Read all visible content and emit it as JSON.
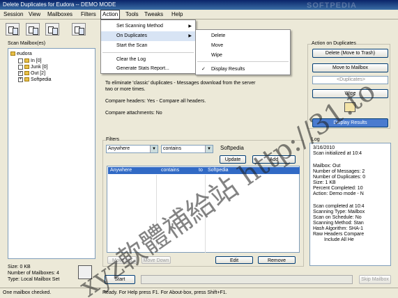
{
  "window": {
    "title": "Delete Duplicates for Eudora -- DEMO MODE",
    "watermark_brand": "SOFTPEDIA"
  },
  "menubar": [
    "Session",
    "View",
    "Mailboxes",
    "Filters",
    "Action",
    "Tools",
    "Tweaks",
    "Help"
  ],
  "action_menu": {
    "items": [
      "Set Scanning Method",
      "On Duplicates",
      "Start the Scan",
      "Clear the Log",
      "Generate Stats Report..."
    ],
    "submenu": [
      "Delete",
      "Move",
      "Wipe",
      "Display Results"
    ]
  },
  "mailboxes": {
    "heading": "Scan Mailbox(es)",
    "root": "eudora",
    "items": [
      "In [0]",
      "Junk [0]",
      "Out [2]",
      "Softpedia"
    ]
  },
  "info": {
    "line1": "To eliminate 'classic' duplicates - Messages download from the server",
    "line2": "two or more times.",
    "line3": "Compare headers: Yes - Compare all headers.",
    "line4": "Compare attachments: No"
  },
  "actions": {
    "heading": "Action on Duplicates",
    "delete_btn": "Delete (Move to Trash)",
    "move_btn": "Move to Mailbox",
    "duplicates": "<Duplicates>",
    "wipe_btn": "Wipe",
    "display_btn": "Display Results"
  },
  "filters": {
    "heading": "Filters",
    "field": "Anywhere",
    "op": "contains",
    "value": "Softpedia",
    "update_btn": "Update",
    "add_btn": "Add",
    "row": [
      "Anywhere",
      "contains",
      "to",
      "Softpedia"
    ],
    "moveup_btn": "Move Up",
    "movedown_btn": "Move Down",
    "edit_btn": "Edit",
    "remove_btn": "Remove"
  },
  "log": {
    "heading": "Log",
    "lines": [
      "3/16/2010",
      "Scan initialized at 10:4",
      "",
      "Mailbox: Out",
      "Number of Messages: 2",
      "Number of Duplicates: 0",
      "Size: 1 KB",
      "Percent Completed: 10",
      "Action: Demo mode - N",
      "",
      "Scan completed at 10:4",
      "Scanning Type: Mailbox",
      "Scan on Schedule: No",
      "Scanning Method: Stan",
      "Hash Algorithm: SHA-1",
      "Raw Headers Compare",
      "Include All He"
    ]
  },
  "stats": {
    "size": "Size: 0 KB",
    "mailboxes": "Number of Mailboxes: 4",
    "type": "Type: Local Mailbox Set"
  },
  "buttons": {
    "start": "Start",
    "skip": "Skip Mailbox"
  },
  "status": {
    "left": "One mailbox checked.",
    "right": "Ready. For Help press F1. For About-box, press Shift+F1."
  },
  "overlay": {
    "url": "xyz軟體補給站 http://31.to"
  }
}
